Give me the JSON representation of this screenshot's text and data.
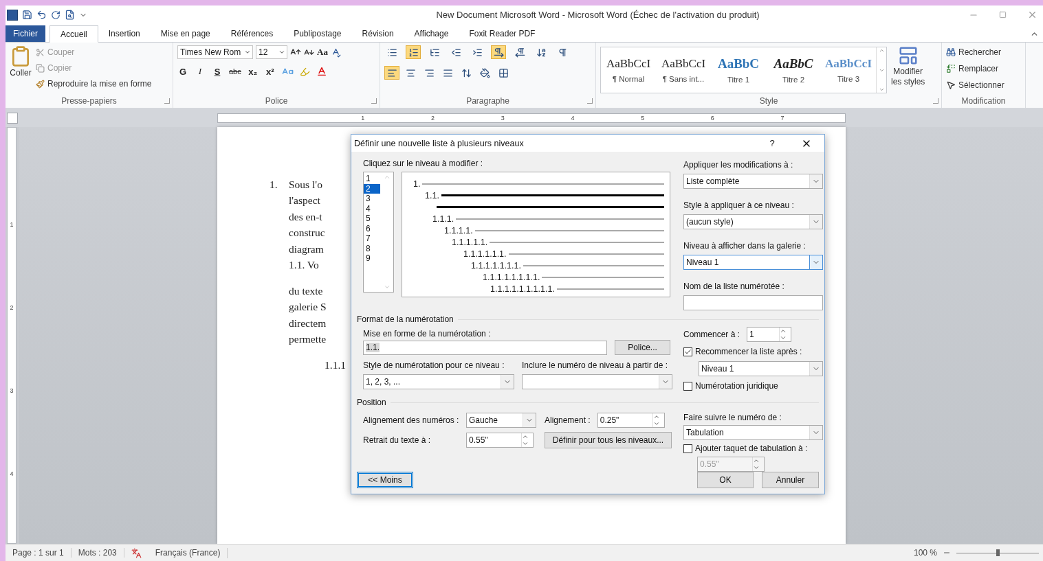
{
  "title_bar": {
    "title": "New Document Microsoft Word  -  Microsoft Word (Échec de l'activation du produit)"
  },
  "ribbon_tabs": [
    {
      "label": "Fichier",
      "kind": "file",
      "selected": false
    },
    {
      "label": "Accueil",
      "kind": "tab",
      "selected": true
    },
    {
      "label": "Insertion",
      "kind": "tab",
      "selected": false
    },
    {
      "label": "Mise en page",
      "kind": "tab",
      "selected": false
    },
    {
      "label": "Références",
      "kind": "tab",
      "selected": false
    },
    {
      "label": "Publipostage",
      "kind": "tab",
      "selected": false
    },
    {
      "label": "Révision",
      "kind": "tab",
      "selected": false
    },
    {
      "label": "Affichage",
      "kind": "tab",
      "selected": false
    },
    {
      "label": "Foxit Reader PDF",
      "kind": "tab",
      "selected": false
    }
  ],
  "ribbon": {
    "clipboard": {
      "name": "Presse-papiers",
      "paste": "Coller",
      "cut": "Couper",
      "copy": "Copier",
      "format_painter": "Reproduire la mise en forme"
    },
    "font": {
      "name": "Police",
      "font_name": "Times New Rom",
      "font_size": "12",
      "case": "Aa",
      "format_buttons": [
        {
          "label": "G",
          "kind": "bold"
        },
        {
          "label": "I",
          "kind": "italic"
        },
        {
          "label": "S",
          "kind": "underline"
        },
        {
          "label": "abc",
          "kind": "strike"
        },
        {
          "label": "x₂",
          "kind": "sub"
        },
        {
          "label": "x²",
          "kind": "sup"
        }
      ]
    },
    "paragraph": {
      "name": "Paragraphe",
      "top": [
        {
          "kind": "bullets",
          "selected": false
        },
        {
          "kind": "numbering",
          "selected": true
        },
        {
          "kind": "multilevel",
          "selected": false
        },
        {
          "kind": "outdent",
          "selected": false
        },
        {
          "kind": "indent",
          "selected": false
        },
        {
          "kind": "ltr",
          "selected": true
        },
        {
          "kind": "rtl",
          "selected": false
        },
        {
          "kind": "sort",
          "selected": false
        },
        {
          "kind": "pilcrow",
          "selected": false
        }
      ],
      "bottom": [
        {
          "kind": "left",
          "selected": true
        },
        {
          "kind": "center",
          "selected": false
        },
        {
          "kind": "right",
          "selected": false
        },
        {
          "kind": "justify",
          "selected": false
        },
        {
          "kind": "spacing",
          "selected": false
        },
        {
          "kind": "shading",
          "selected": false
        },
        {
          "kind": "borders",
          "selected": false
        }
      ]
    },
    "styles": {
      "name": "Style",
      "items": [
        {
          "sample": "AaBbCcI",
          "label": "¶ Normal",
          "kind": "normal"
        },
        {
          "sample": "AaBbCcI",
          "label": "¶ Sans int...",
          "kind": "normal"
        },
        {
          "sample": "AaBbC",
          "label": "Titre 1",
          "kind": "heading1"
        },
        {
          "sample": "AaBbC",
          "label": "Titre 2",
          "kind": "heading2"
        },
        {
          "sample": "AaBbCcI",
          "label": "Titre 3",
          "kind": "heading3"
        }
      ],
      "change_line1": "Modifier",
      "change_line2": "les styles"
    },
    "editing": {
      "name": "Modification",
      "find": "Rechercher",
      "replace": "Remplacer",
      "select": "Sélectionner"
    }
  },
  "ruler": {
    "marks": [
      "1",
      "2",
      "3",
      "4",
      "5",
      "6",
      "7"
    ],
    "vertical_marks": [
      "1",
      "2",
      "3",
      "4"
    ]
  },
  "document": {
    "paragraphs": [
      {
        "kind": "list_item",
        "number": "1.",
        "lines": [
          "Sous l'o",
          "l'aspect",
          "des en-t",
          "construc",
          "diagram",
          "1.1. Vo"
        ]
      },
      {
        "kind": "body",
        "lines": [
          "du texte",
          "galerie S",
          "directem",
          "permette"
        ]
      },
      {
        "kind": "sublevel",
        "lines": [
          "1.1.1"
        ]
      }
    ]
  },
  "dialog": {
    "title": "Définir une nouvelle liste à plusieurs niveaux",
    "help": "?",
    "level_label": "Cliquez sur le niveau à modifier :",
    "levels": [
      {
        "label": "1",
        "selected": false
      },
      {
        "label": "2",
        "selected": true
      },
      {
        "label": "3",
        "selected": false
      },
      {
        "label": "4",
        "selected": false
      },
      {
        "label": "5",
        "selected": false
      },
      {
        "label": "6",
        "selected": false
      },
      {
        "label": "7",
        "selected": false
      },
      {
        "label": "8",
        "selected": false
      },
      {
        "label": "9",
        "selected": false
      }
    ],
    "preview": [
      {
        "number": "1.",
        "kind": "other"
      },
      {
        "number": "1.1.",
        "kind": "current"
      },
      {
        "kind": "continuation"
      },
      {
        "number": "1.1.1.",
        "kind": "other"
      },
      {
        "number": "1.1.1.1.",
        "kind": "other"
      },
      {
        "number": "1.1.1.1.1.",
        "kind": "other"
      },
      {
        "number": "1.1.1.1.1.1.",
        "kind": "other"
      },
      {
        "number": "1.1.1.1.1.1.1.",
        "kind": "other"
      },
      {
        "number": "1.1.1.1.1.1.1.1.",
        "kind": "other"
      },
      {
        "number": "1.1.1.1.1.1.1.1.1.",
        "kind": "other"
      }
    ],
    "apply_to": {
      "label": "Appliquer les modifications à :",
      "value": "Liste complète"
    },
    "level_style": {
      "label": "Style à appliquer à ce niveau :",
      "value": "(aucun style)"
    },
    "gallery_level": {
      "label": "Niveau à afficher dans la galerie :",
      "value": "Niveau 1",
      "focused": true
    },
    "list_name": {
      "label": "Nom de la liste numérotée :"
    },
    "format_section": "Format de la numérotation",
    "number_format": {
      "label": "Mise en forme de la numérotation :",
      "value": "1.1."
    },
    "font_button": "Police...",
    "number_style": {
      "label": "Style de numérotation pour ce niveau :",
      "value": "1, 2, 3, ..."
    },
    "include_level": {
      "label": "Inclure le numéro de niveau à partir de :"
    },
    "start_at": {
      "label": "Commencer à :",
      "value": "1"
    },
    "restart": {
      "label": "Recommencer la liste après :",
      "checked": true,
      "value": "Niveau 1"
    },
    "legal": {
      "label": "Numérotation juridique",
      "checked": false
    },
    "position_section": "Position",
    "number_alignment": {
      "label": "Alignement des numéros :",
      "value": "Gauche"
    },
    "aligned_at": {
      "label": "Alignement :",
      "value": "0.25\""
    },
    "text_indent": {
      "label": "Retrait du texte à :",
      "value": "0.55\""
    },
    "set_all_button": "Définir pour tous les niveaux...",
    "follow_with": {
      "label": "Faire suivre le numéro de :",
      "value": "Tabulation"
    },
    "tab_stop": {
      "label": "Ajouter taquet de tabulation à :",
      "checked": false,
      "value": "0.55\""
    },
    "less_button": "<< Moins",
    "ok_button": "OK",
    "cancel_button": "Annuler"
  },
  "status_bar": {
    "page": "Page : 1 sur 1",
    "words": "Mots : 203",
    "language": "Français (France)",
    "zoom": "100 %",
    "zoom_slider": {
      "level": 0.5
    }
  }
}
